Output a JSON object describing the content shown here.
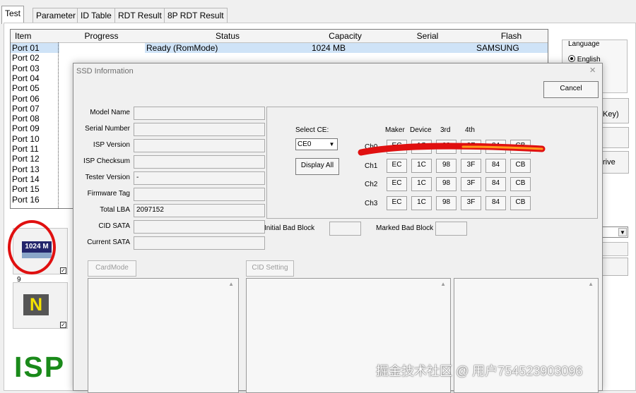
{
  "tabs": [
    "Test",
    "Parameter",
    "ID Table",
    "RDT Result",
    "8P RDT Result"
  ],
  "grid": {
    "columns": [
      "Item",
      "Progress",
      "Status",
      "Capacity",
      "Serial",
      "Flash"
    ],
    "rows": [
      {
        "item": "Port 01",
        "status": "Ready (RomMode)",
        "capacity": "1024 MB",
        "flash": "SAMSUNG"
      },
      {
        "item": "Port 02"
      },
      {
        "item": "Port 03"
      },
      {
        "item": "Port 04"
      },
      {
        "item": "Port 05"
      },
      {
        "item": "Port 06"
      },
      {
        "item": "Port 07"
      },
      {
        "item": "Port 08"
      },
      {
        "item": "Port 09"
      },
      {
        "item": "Port 10"
      },
      {
        "item": "Port 11"
      },
      {
        "item": "Port 12"
      },
      {
        "item": "Port 13"
      },
      {
        "item": "Port 14"
      },
      {
        "item": "Port 15"
      },
      {
        "item": "Port 16"
      }
    ]
  },
  "side": {
    "language_title": "Language",
    "language_option": "English",
    "key_suffix": "Key)",
    "drive_suffix": "rive"
  },
  "device": {
    "capacity_badge": "1024 M",
    "count": "9",
    "n_label": "N",
    "isp_text": "ISP",
    "colors": {
      "capacity_bg": "#23256b",
      "n_fg": "#f5e300",
      "isp_fg": "#1a8a1a",
      "red_mark": "#e01010"
    }
  },
  "dialog": {
    "title": "SSD Information",
    "cancel": "Cancel",
    "fields": [
      {
        "label": "Model Name",
        "value": ""
      },
      {
        "label": "Serial Number",
        "value": ""
      },
      {
        "label": "ISP Version",
        "value": ""
      },
      {
        "label": "ISP Checksum",
        "value": ""
      },
      {
        "label": "Tester Version",
        "value": "-"
      },
      {
        "label": "Firmware Tag",
        "value": ""
      },
      {
        "label": "Total LBA",
        "value": "2097152"
      },
      {
        "label": "CID SATA",
        "value": ""
      },
      {
        "label": "Current SATA",
        "value": ""
      }
    ],
    "select_ce_label": "Select CE:",
    "select_ce_value": "CE0",
    "display_all": "Display All",
    "ce_headers": [
      "Maker",
      "Device",
      "3rd",
      "4th"
    ],
    "ce_rows": [
      {
        "ch": "Ch0",
        "values": [
          "EC",
          "1C",
          "98",
          "3F",
          "84",
          "CB"
        ]
      },
      {
        "ch": "Ch1",
        "values": [
          "EC",
          "1C",
          "98",
          "3F",
          "84",
          "CB"
        ]
      },
      {
        "ch": "Ch2",
        "values": [
          "EC",
          "1C",
          "98",
          "3F",
          "84",
          "CB"
        ]
      },
      {
        "ch": "Ch3",
        "values": [
          "EC",
          "1C",
          "98",
          "3F",
          "84",
          "CB"
        ]
      }
    ],
    "initial_bad_block": "Initial Bad Block",
    "marked_bad_block": "Marked Bad Block",
    "card_mode": "CardMode",
    "cid_setting": "CID Setting"
  },
  "watermark": "掘金技术社区 @ 用户754523903096"
}
